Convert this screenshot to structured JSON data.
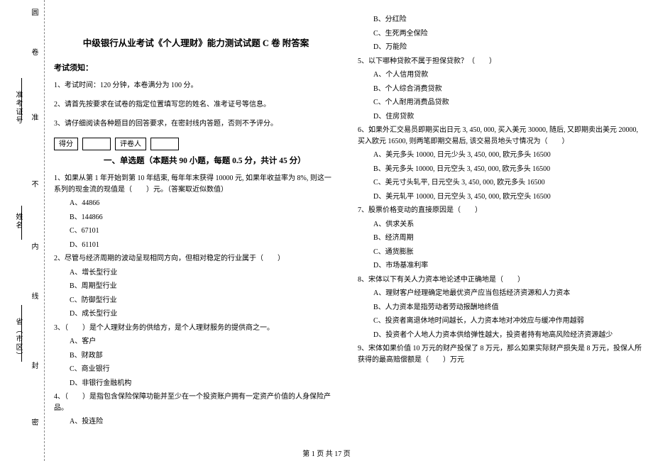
{
  "binding": {
    "zhou": "圆",
    "can": "卷",
    "zkz": "准考证号",
    "zhun": "准",
    "bu": "不",
    "name": "姓名",
    "nei": "内",
    "xian": "线",
    "prov": "省（市区）",
    "feng": "封",
    "mi": "密"
  },
  "title": "中级银行从业考试《个人理财》能力测试试题 C 卷 附答案",
  "notice_head": "考试须知：",
  "instructions": [
    "1、考试时间：120 分钟，本卷满分为 100 分。",
    "2、请首先按要求在试卷的指定位置填写您的姓名、准考证号等信息。",
    "3、请仔细阅读各种题目的回答要求，在密封线内答题，否则不予评分。"
  ],
  "score_labels": {
    "score": "得分",
    "grader": "评卷人"
  },
  "section1_title": "一、单选题（本题共 90 小题，每题 0.5 分，共计 45 分）",
  "q1": {
    "stem": "1、如果从第 1 年开始到第 10 年结束, 每年年末获得 10000 元, 如果年收益率为 8%, 则这一系列的现金流的现值是（　　）元。（答案取近似数值）",
    "opts": [
      "A、44866",
      "B、144866",
      "C、67101",
      "D、61101"
    ]
  },
  "q2": {
    "stem": "2、尽管与经济周期的波动呈现相同方向，但相对稳定的行业属于（　　）",
    "opts": [
      "A、增长型行业",
      "B、周期型行业",
      "C、防御型行业",
      "D、成长型行业"
    ]
  },
  "q3": {
    "stem": "3、（　　）是个人理财业务的供给方，是个人理财服务的提供商之一。",
    "opts": [
      "A、客户",
      "B、财政部",
      "C、商业银行",
      "D、非银行金融机构"
    ]
  },
  "q4": {
    "stem": "4、（　　）是指包含保险保障功能并至少在一个投资账户拥有一定资产价值的人身保险产品。",
    "opts": [
      "A、投连险",
      "B、分红险",
      "C、生死两全保险",
      "D、万能险"
    ]
  },
  "q5": {
    "stem": "5、以下哪种贷款不属于担保贷款？（　　）",
    "opts": [
      "A、个人信用贷款",
      "B、个人综合消费贷款",
      "C、个人耐用消费品贷款",
      "D、住房贷款"
    ]
  },
  "q6": {
    "stem": "6、如果外汇交易员即期买出日元 3, 450, 000, 买入美元 30000, 随后, 又即期卖出美元 20000, 买入欧元 16500, 则两笔即期交易后, 该交易员地头寸情况为（　　）",
    "opts": [
      "A、美元多头 10000, 日元少头 3, 450, 000, 欧元多头 16500",
      "B、美元多头 10000, 日元空头 3, 450, 000, 欧元多头 16500",
      "C、美元寸头轧平, 日元空头 3, 450, 000, 欧元多头 16500",
      "D、美元轧平 10000, 日元空头 3, 450, 000, 欧元空头 16500"
    ]
  },
  "q7": {
    "stem": "7、股票价格变动的直接原因是（　　）",
    "opts": [
      "A、供求关系",
      "B、经济周期",
      "C、通货膨胀",
      "D、市场基准利率"
    ]
  },
  "q8": {
    "stem": "8、宋体以下有关人力资本地论述中正确地是（　　）",
    "opts": [
      "A、理财客户经理确定地最优资产应当包括经济资源和人力资本",
      "B、人力资本是指劳动者劳动报酬地终值",
      "C、投资者离退休地时间越长，人力资本地对冲效应与缓冲作用越弱",
      "D、投资者个人地人力资本供给弹性越大，投资者持有地高风险经济资源越少"
    ]
  },
  "q9": {
    "stem": "9、宋体如果价值 10 万元的财产投保了 8 万元，那么如果实际财产损失是 8 万元，投保人所获得的最高赔偿额是（　　）万元",
    "opts": []
  },
  "pager": "第 1 页 共 17 页"
}
